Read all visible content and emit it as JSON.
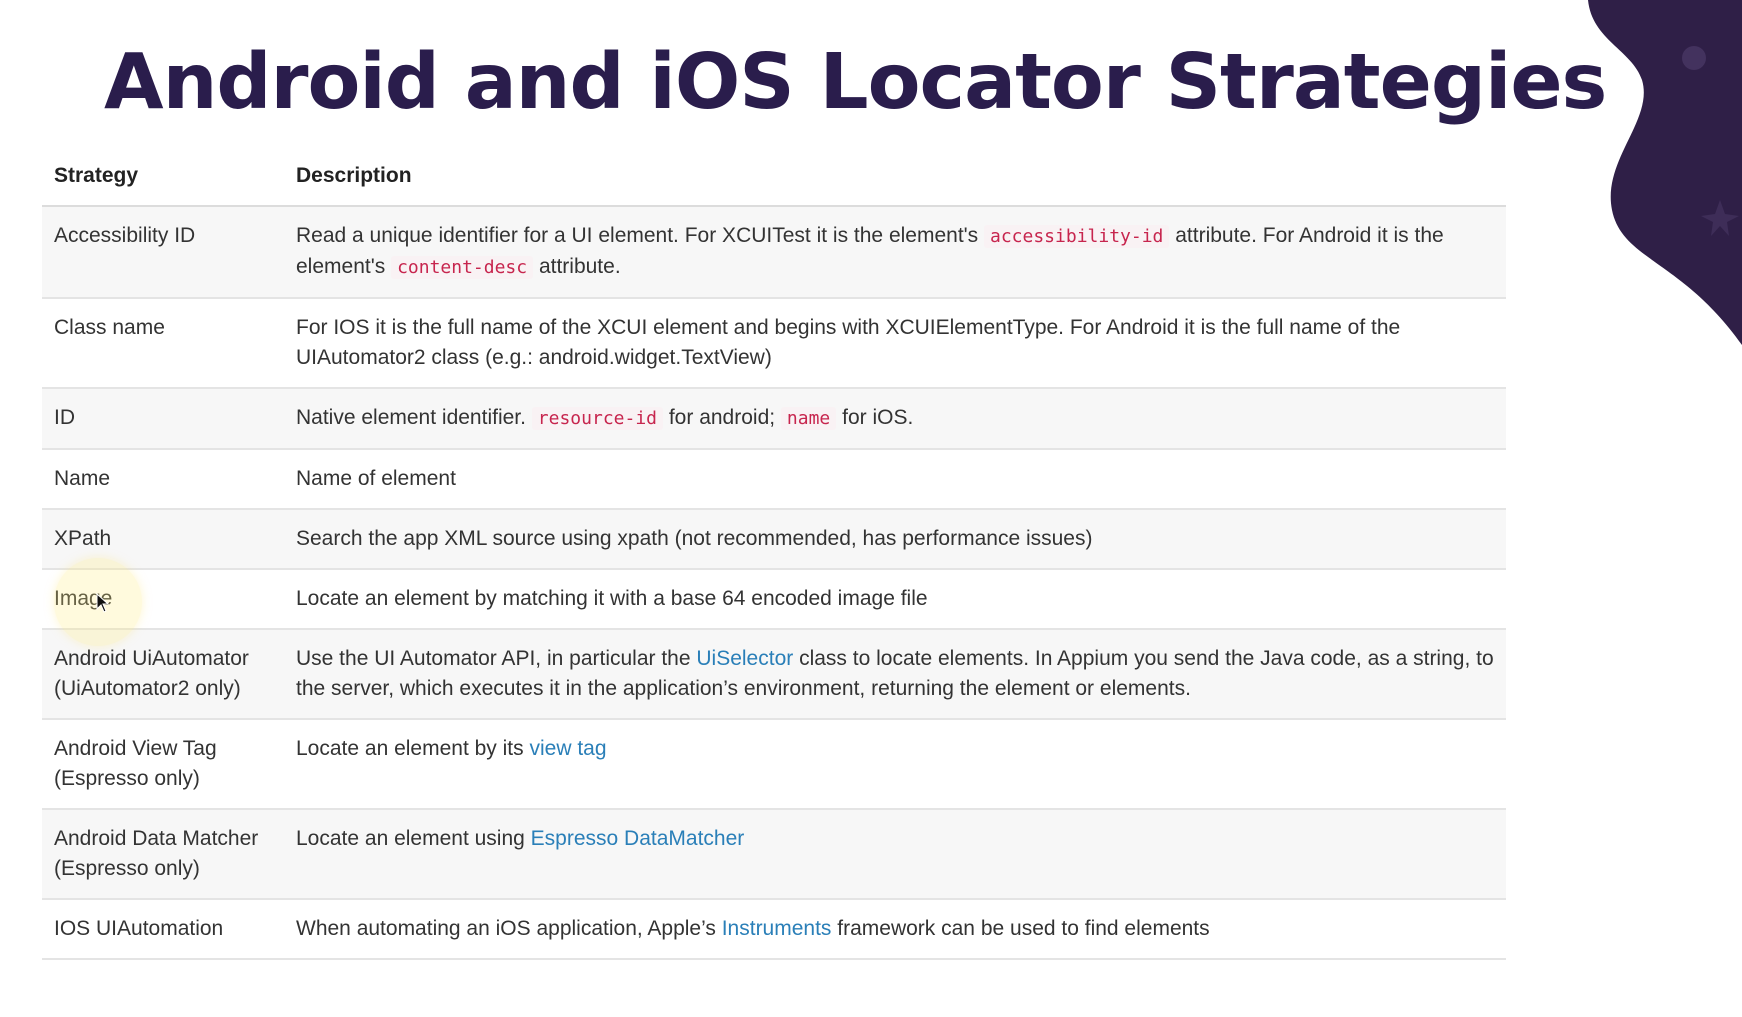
{
  "slide": {
    "title": "Android and iOS Locator Strategies",
    "colors": {
      "title": "#2a1d4c",
      "blob": "#2f1f47",
      "code": "#c7254e",
      "link": "#2a7fb8"
    }
  },
  "table": {
    "headers": {
      "strategy": "Strategy",
      "description": "Description"
    },
    "rows": [
      {
        "strategy": "Accessibility ID",
        "desc": [
          {
            "t": "Read a unique identifier for a UI element. For XCUITest it is the element's "
          },
          {
            "t": "accessibility-id",
            "k": "code"
          },
          {
            "t": " attribute. For Android it is the element's "
          },
          {
            "t": "content-desc",
            "k": "code"
          },
          {
            "t": " attribute."
          }
        ]
      },
      {
        "strategy": "Class name",
        "desc": [
          {
            "t": "For IOS it is the full name of the XCUI element and begins with XCUIElementType. For Android it is the full name of the UIAutomator2 class (e.g.: android.widget.TextView)"
          }
        ]
      },
      {
        "strategy": "ID",
        "desc": [
          {
            "t": "Native element identifier. "
          },
          {
            "t": "resource-id",
            "k": "code"
          },
          {
            "t": " for android; "
          },
          {
            "t": "name",
            "k": "code"
          },
          {
            "t": " for iOS."
          }
        ]
      },
      {
        "strategy": "Name",
        "desc": [
          {
            "t": "Name of element"
          }
        ]
      },
      {
        "strategy": "XPath",
        "desc": [
          {
            "t": "Search the app XML source using xpath (not recommended, has performance issues)"
          }
        ]
      },
      {
        "strategy": "Image",
        "desc": [
          {
            "t": "Locate an element by matching it with a base 64 encoded image file"
          }
        ]
      },
      {
        "strategy": "Android UiAutomator (UiAutomator2 only)",
        "desc": [
          {
            "t": "Use the UI Automator API, in particular the "
          },
          {
            "t": "UiSelector",
            "k": "link"
          },
          {
            "t": " class to locate elements. In Appium you send the Java code, as a string, to the server, which executes it in the application’s environment, returning the element or elements."
          }
        ]
      },
      {
        "strategy": "Android View Tag (Espresso only)",
        "desc": [
          {
            "t": "Locate an element by its "
          },
          {
            "t": "view tag",
            "k": "link"
          }
        ]
      },
      {
        "strategy": "Android Data Matcher (Espresso only)",
        "desc": [
          {
            "t": "Locate an element using "
          },
          {
            "t": "Espresso DataMatcher",
            "k": "link"
          }
        ]
      },
      {
        "strategy": "IOS UIAutomation",
        "desc": [
          {
            "t": "When automating an iOS application, Apple’s "
          },
          {
            "t": "Instruments",
            "k": "link"
          },
          {
            "t": " framework can be used to find elements"
          }
        ]
      }
    ]
  }
}
